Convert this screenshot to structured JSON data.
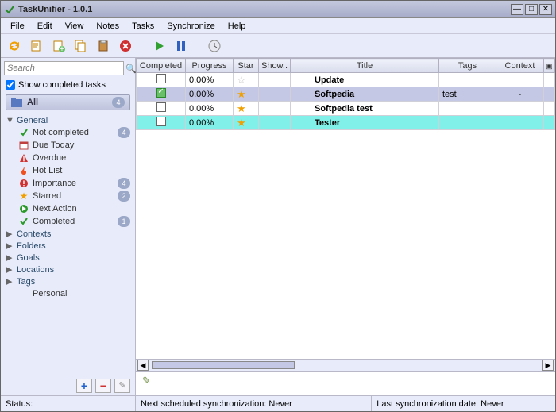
{
  "window": {
    "title": "TaskUnifier - 1.0.1"
  },
  "menu": [
    "File",
    "Edit",
    "View",
    "Notes",
    "Tasks",
    "Synchronize",
    "Help"
  ],
  "search": {
    "placeholder": "Search"
  },
  "show_completed": {
    "label": "Show completed tasks",
    "checked": true
  },
  "all_row": {
    "label": "All",
    "count": "4"
  },
  "tree": [
    {
      "label": "General",
      "expanded": true,
      "children": [
        {
          "icon": "check-green",
          "label": "Not completed",
          "badge": "4"
        },
        {
          "icon": "calendar",
          "label": "Due Today"
        },
        {
          "icon": "warning-red",
          "label": "Overdue"
        },
        {
          "icon": "flame",
          "label": "Hot List"
        },
        {
          "icon": "excl-red",
          "label": "Importance",
          "badge": "4"
        },
        {
          "icon": "star",
          "label": "Starred",
          "badge": "2"
        },
        {
          "icon": "arrow-green",
          "label": "Next Action"
        },
        {
          "icon": "check-green",
          "label": "Completed",
          "badge": "1"
        }
      ]
    },
    {
      "label": "Contexts",
      "expanded": false
    },
    {
      "label": "Folders",
      "expanded": false
    },
    {
      "label": "Goals",
      "expanded": false
    },
    {
      "label": "Locations",
      "expanded": false
    },
    {
      "label": "Tags",
      "expanded": false,
      "children": [
        {
          "icon": "",
          "label": "Personal"
        }
      ],
      "showchild": true
    }
  ],
  "grid": {
    "headers": [
      "Completed",
      "Progress",
      "Star",
      "Show..",
      "Title",
      "Tags",
      "Context"
    ],
    "rows": [
      {
        "completed": false,
        "completedGreen": false,
        "progress": "0.00%",
        "star": false,
        "title": "Update",
        "tags": "",
        "context": "",
        "style": "row1",
        "strike": false
      },
      {
        "completed": true,
        "completedGreen": true,
        "progress": "0.00%",
        "star": true,
        "title": "Softpedia",
        "tags": "test",
        "context": "-",
        "style": "rowsel",
        "strike": true
      },
      {
        "completed": false,
        "completedGreen": false,
        "progress": "0.00%",
        "star": true,
        "title": "Softpedia test",
        "tags": "",
        "context": "",
        "style": "row1",
        "strike": false
      },
      {
        "completed": false,
        "completedGreen": false,
        "progress": "0.00%",
        "star": true,
        "title": "Tester",
        "tags": "",
        "context": "",
        "style": "rowhl",
        "strike": false
      }
    ]
  },
  "status": {
    "left": "Status:",
    "mid": "Next scheduled synchronization: Never",
    "right": "Last synchronization date: Never"
  },
  "icons": {
    "search": "🔍",
    "add": "+",
    "delete": "−",
    "edit": "✎"
  }
}
